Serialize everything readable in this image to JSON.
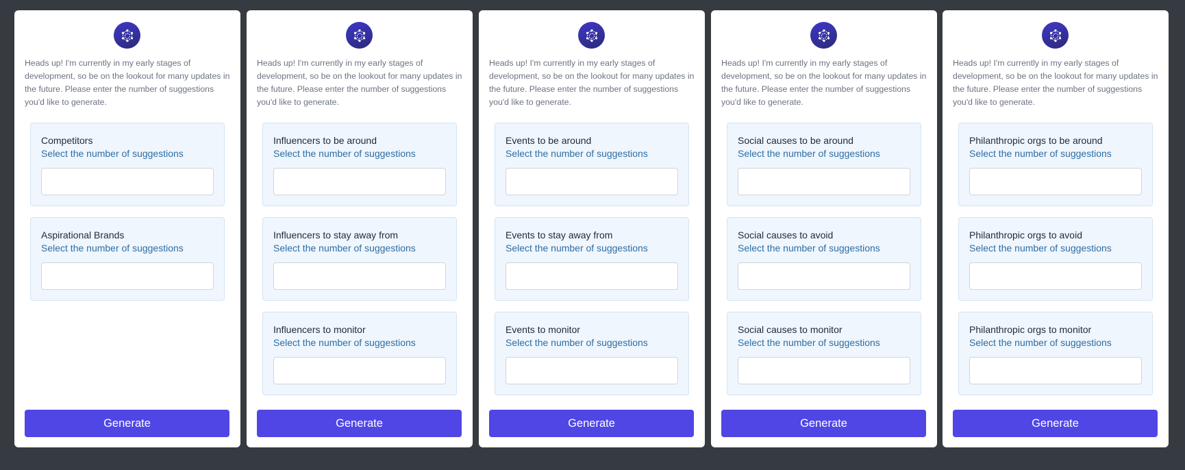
{
  "notice": "Heads up! I'm currently in my early stages of development, so be on the lookout for many updates in the future. Please enter the number of suggestions you'd like to generate.",
  "subtitle": "Select the number of suggestions",
  "generate_label": "Generate",
  "logo_icon": "network-hexagon-icon",
  "colors": {
    "background": "#363b41",
    "card": "#ffffff",
    "section_bg": "#eff6fd",
    "section_border": "#d3e4f3",
    "accent": "#4f46e5",
    "subtitle": "#2e6da4"
  },
  "cards": [
    {
      "sections": [
        {
          "title": "Competitors",
          "value": ""
        },
        {
          "title": "Aspirational Brands",
          "value": ""
        }
      ]
    },
    {
      "sections": [
        {
          "title": "Influencers to be around",
          "value": ""
        },
        {
          "title": "Influencers to stay away from",
          "value": ""
        },
        {
          "title": "Influencers to monitor",
          "value": ""
        }
      ]
    },
    {
      "sections": [
        {
          "title": "Events to be around",
          "value": ""
        },
        {
          "title": "Events to stay away from",
          "value": ""
        },
        {
          "title": "Events to monitor",
          "value": ""
        }
      ]
    },
    {
      "sections": [
        {
          "title": "Social causes to be around",
          "value": ""
        },
        {
          "title": "Social causes to avoid",
          "value": ""
        },
        {
          "title": "Social causes to monitor",
          "value": ""
        }
      ]
    },
    {
      "sections": [
        {
          "title": "Philanthropic orgs to be around",
          "value": ""
        },
        {
          "title": "Philanthropic orgs to avoid",
          "value": ""
        },
        {
          "title": "Philanthropic orgs to monitor",
          "value": ""
        }
      ]
    }
  ]
}
